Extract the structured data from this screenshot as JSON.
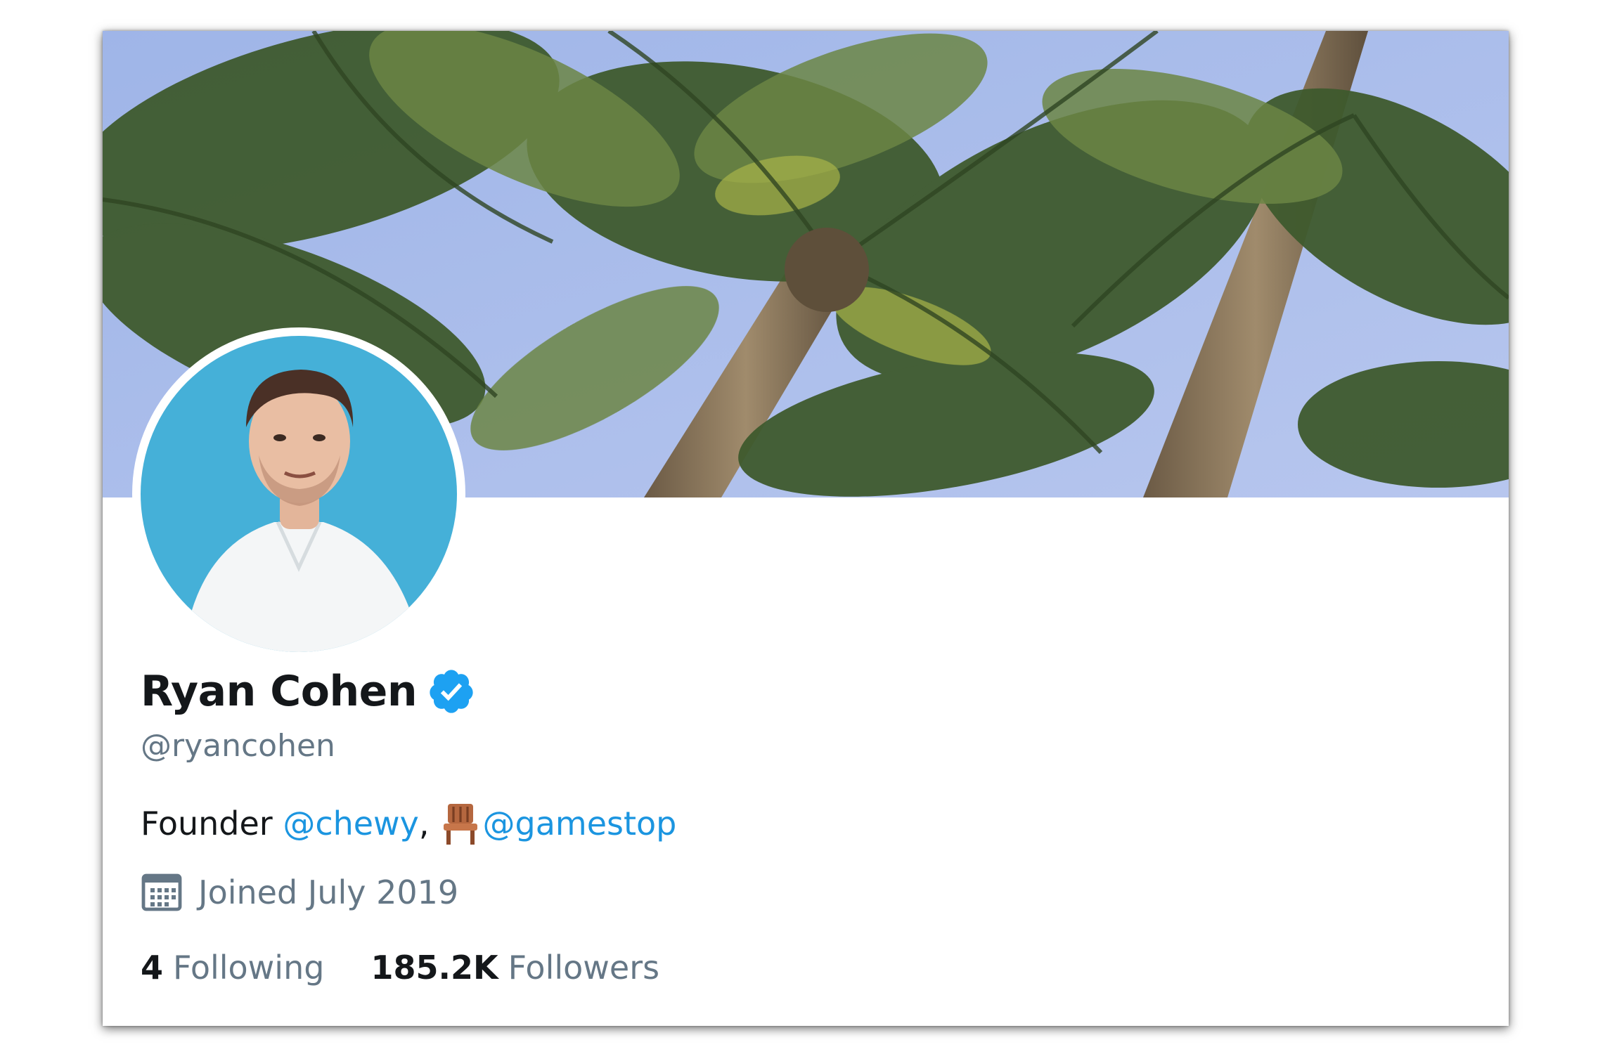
{
  "profile": {
    "display_name": "Ryan Cohen",
    "handle": "@ryancohen",
    "verified": true,
    "bio": {
      "prefix": "Founder ",
      "mention1": "@chewy",
      "separator": ",",
      "emoji": "chair-emoji",
      "mention2": "@gamestop"
    },
    "joined": "Joined July 2019",
    "following_count": "4",
    "following_label": "Following",
    "followers_count": "185.2K",
    "followers_label": "Followers"
  },
  "icons": {
    "verified": "verified-badge-icon",
    "calendar": "calendar-icon",
    "bio_emoji": "chair-icon"
  },
  "colors": {
    "link": "#1b95e0",
    "secondary_text": "#657786",
    "primary_text": "#14171a",
    "verified_badge": "#1da1f2",
    "avatar_background": "#45b0d8"
  }
}
